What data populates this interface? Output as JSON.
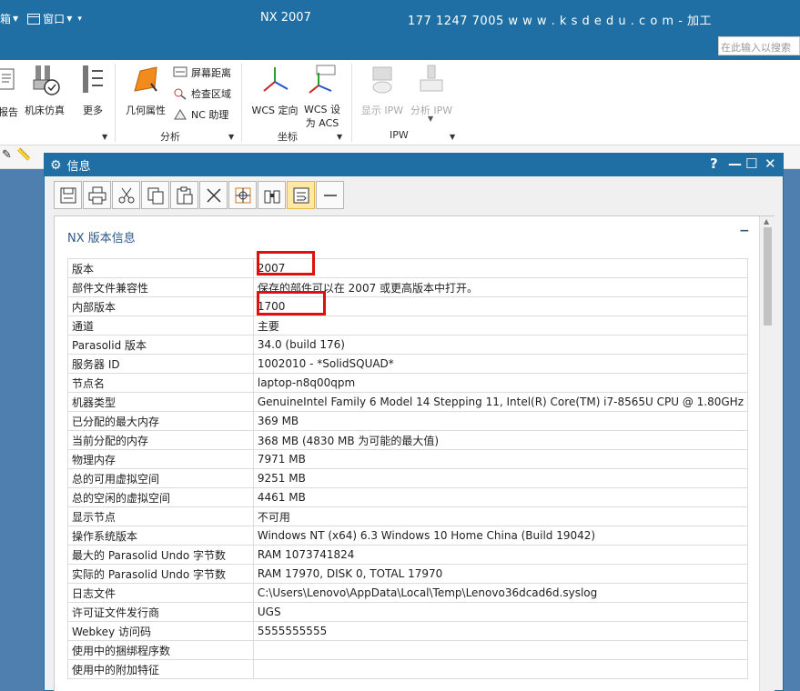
{
  "titlebar": {
    "menu_left": "箱",
    "menu_window": "窗口",
    "title": "NX 2007",
    "contact": "177 1247 7005   w w w . k s d e d u . c o m - 加工",
    "search_placeholder": "在此输入以搜索"
  },
  "ribbon": {
    "report_label": "报告",
    "machine_sim_label": "机床仿真",
    "more_label": "更多",
    "geom_props_label": "几何属性",
    "screen_distance_label": "屏幕距离",
    "check_area_label": "检查区域",
    "nc_assistant_label": "NC 助理",
    "wcs_orient_label": "WCS 定向",
    "wcs_set_acs_label": "WCS 设为 ACS",
    "show_ipw_label": "显示 IPW",
    "analyze_ipw_label": "分析 IPW",
    "group_analysis": "分析",
    "group_coords": "坐标",
    "group_ipw": "IPW"
  },
  "dialog": {
    "title": "信息",
    "help": "?",
    "section_title": "NX 版本信息",
    "collapse_glyph": "−"
  },
  "info_rows": [
    {
      "key": "版本",
      "value": "2007"
    },
    {
      "key": "部件文件兼容性",
      "value": "保存的部件可以在 2007 或更高版本中打开。"
    },
    {
      "key": "内部版本",
      "value": "1700"
    },
    {
      "key": "通道",
      "value": "主要"
    },
    {
      "key": "Parasolid 版本",
      "value": "34.0 (build 176)"
    },
    {
      "key": "服务器 ID",
      "value": "1002010 - *SolidSQUAD*"
    },
    {
      "key": "节点名",
      "value": "laptop-n8q00qpm"
    },
    {
      "key": "机器类型",
      "value": "GenuineIntel Family 6 Model 14 Stepping 11, Intel(R) Core(TM) i7-8565U CPU @ 1.80GHz"
    },
    {
      "key": "已分配的最大内存",
      "value": "369 MB"
    },
    {
      "key": "当前分配的内存",
      "value": "368 MB (4830 MB 为可能的最大值)"
    },
    {
      "key": "物理内存",
      "value": "7971 MB"
    },
    {
      "key": "总的可用虚拟空间",
      "value": "9251 MB"
    },
    {
      "key": "总的空闲的虚拟空间",
      "value": "4461 MB"
    },
    {
      "key": "显示节点",
      "value": "不可用"
    },
    {
      "key": "操作系统版本",
      "value": "Windows NT (x64) 6.3 Windows 10 Home China (Build 19042)"
    },
    {
      "key": "最大的 Parasolid Undo 字节数",
      "value": "RAM 1073741824"
    },
    {
      "key": "实际的 Parasolid Undo 字节数",
      "value": "RAM 17970, DISK 0, TOTAL 17970"
    },
    {
      "key": "日志文件",
      "value": "C:\\Users\\Lenovo\\AppData\\Local\\Temp\\Lenovo36dcad6d.syslog"
    },
    {
      "key": "许可证文件发行商",
      "value": "UGS"
    },
    {
      "key": "Webkey 访问码",
      "value": "5555555555"
    },
    {
      "key": "使用中的捆绑程序数",
      "value": ""
    },
    {
      "key": "使用中的附加特征",
      "value": ""
    }
  ],
  "colors": {
    "titlebar": "#1f6fa4",
    "highlight_box": "#e01010",
    "section_title": "#2e5a86"
  }
}
